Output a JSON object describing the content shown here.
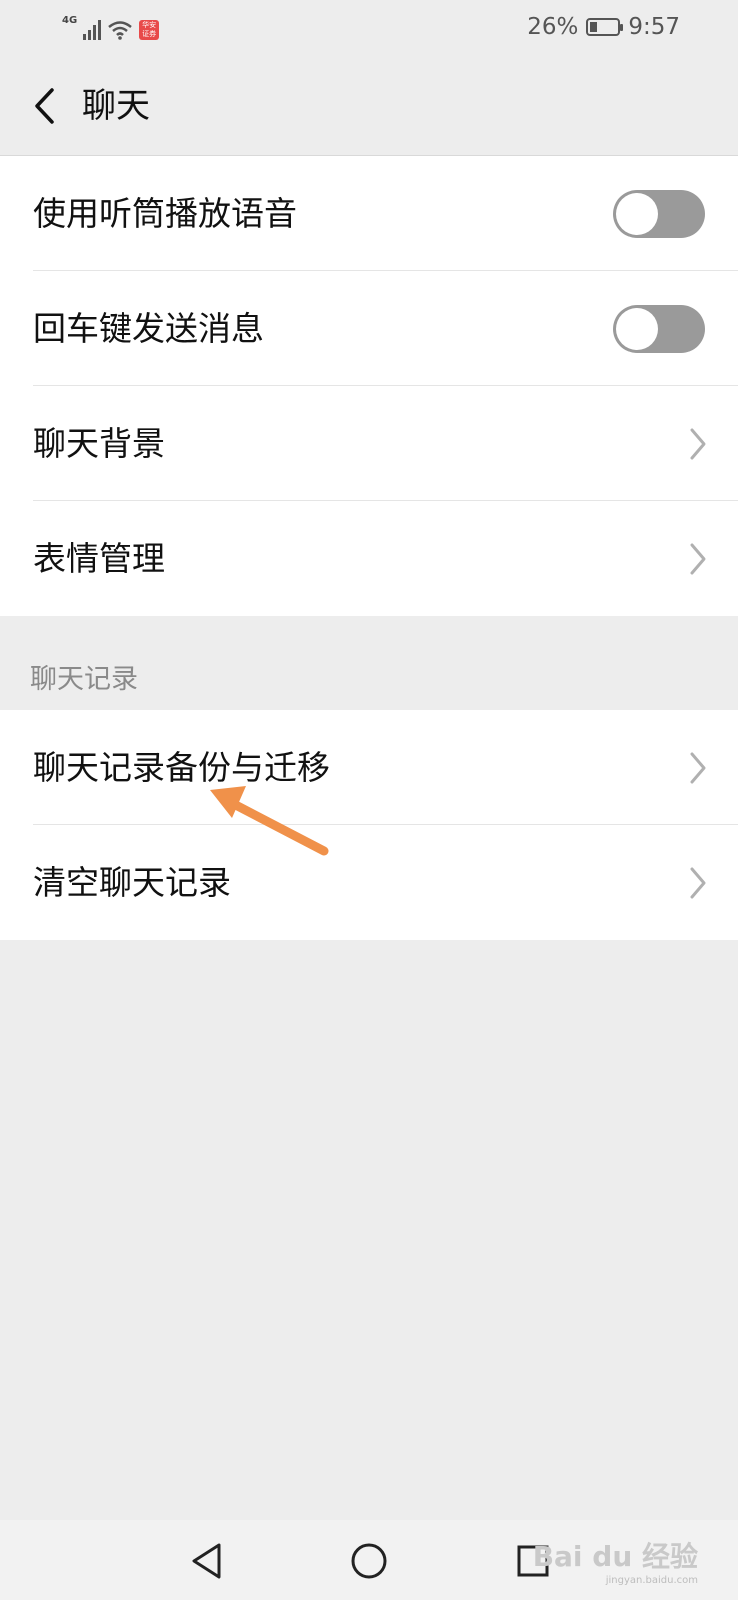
{
  "status_bar": {
    "network": "4G",
    "app_badge": "华安证券",
    "battery_percent": "26%",
    "battery_level": 0.26,
    "time": "9:57"
  },
  "header": {
    "title": "聊天"
  },
  "settings_group_1": {
    "items": [
      {
        "label": "使用听筒播放语音",
        "control": "toggle",
        "on": false
      },
      {
        "label": "回车键发送消息",
        "control": "toggle",
        "on": false
      },
      {
        "label": "聊天背景",
        "control": "chevron"
      },
      {
        "label": "表情管理",
        "control": "chevron"
      }
    ]
  },
  "chat_history_section": {
    "header": "聊天记录",
    "items": [
      {
        "label": "聊天记录备份与迁移",
        "control": "chevron"
      },
      {
        "label": "清空聊天记录",
        "control": "chevron"
      }
    ]
  },
  "annotation": {
    "color": "#f0914a"
  },
  "nav_bar": {
    "buttons": [
      "back-icon",
      "home-icon",
      "recents-icon"
    ]
  },
  "watermark": {
    "brand": "Bai du 经验",
    "url": "jingyan.baidu.com"
  }
}
